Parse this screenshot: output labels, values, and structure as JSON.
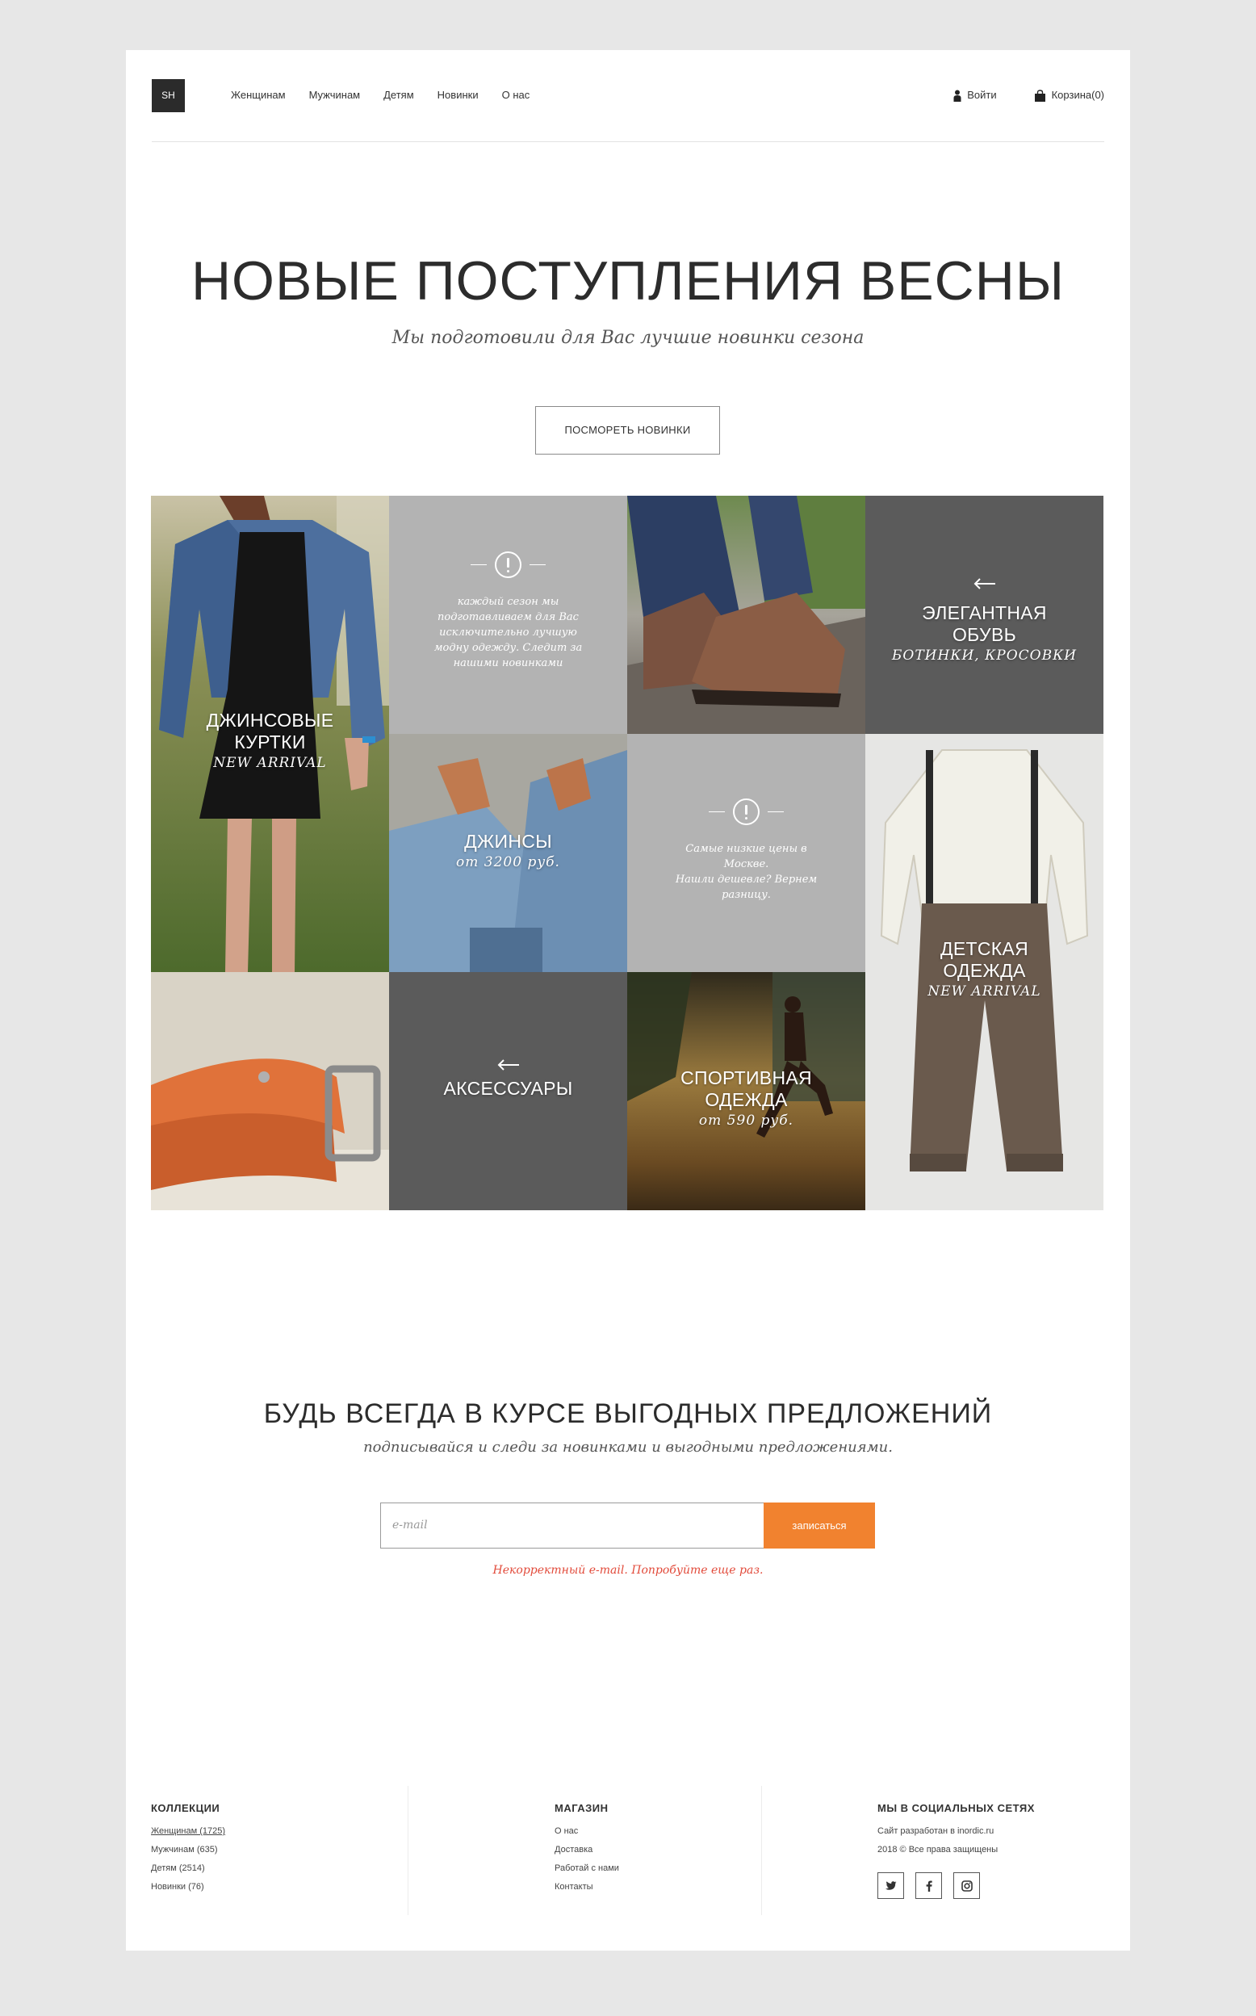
{
  "header": {
    "logo": "SH",
    "nav": [
      "Женщинам",
      "Мужчинам",
      "Детям",
      "Новинки",
      "О нас"
    ],
    "login": "Войти",
    "cart": "Корзина(0)"
  },
  "hero": {
    "title": "НОВЫЕ ПОСТУПЛЕНИЯ ВЕСНЫ",
    "subtitle": "Мы подготовили для Вас лучшие новинки сезона",
    "button": "ПОСМОРЕТЬ НОВИНКИ"
  },
  "tiles": {
    "jackets": {
      "title_1": "ДЖИНСОВЫЕ",
      "title_2": "КУРТКИ",
      "caption": "NEW ARRIVAL"
    },
    "info1": {
      "text_1": "каждый сезон мы",
      "text_2": "подготавливаем для Вас",
      "text_3": "исключительно лучшую",
      "text_4": "модну одежду. Следит за",
      "text_5": "нашими новинками"
    },
    "shoes": {
      "title_1": "ЭЛЕГАНТНАЯ",
      "title_2": "ОБУВЬ",
      "caption": "БОТИНКИ, КРОСОВКИ"
    },
    "jeans": {
      "title": "ДЖИНСЫ",
      "caption": "от 3200 руб."
    },
    "info2": {
      "text_1": "Самые низкие цены в",
      "text_2": "Москве.",
      "text_3": "Нашли дешевле? Вернем",
      "text_4": "разницу."
    },
    "kids": {
      "title_1": "ДЕТСКАЯ",
      "title_2": "ОДЕЖДА",
      "caption": "NEW ARRIVAL"
    },
    "accessories": {
      "title": "АКСЕССУАРЫ"
    },
    "sport": {
      "title_1": "СПОРТИВНАЯ",
      "title_2": "ОДЕЖДА",
      "caption": "от 590 руб."
    }
  },
  "subscribe": {
    "title": "БУДЬ ВСЕГДА В КУРСЕ ВЫГОДНЫХ ПРЕДЛОЖЕНИЙ",
    "text": "подписывайся и следи за новинками и выгодными предложениями.",
    "placeholder": "e-mail",
    "button": "записаться",
    "error": "Некорректный e-mail. Попробуйте еще раз."
  },
  "footer": {
    "collections": {
      "title": "КОЛЛЕКЦИИ",
      "links": [
        "Женщинам (1725)",
        "Мужчинам (635)",
        "Детям (2514)",
        "Новинки (76)"
      ]
    },
    "shop": {
      "title": "МАГАЗИН",
      "links": [
        "О нас",
        "Доставка",
        "Работай с нами",
        "Контакты"
      ]
    },
    "social": {
      "title": "МЫ В СОЦИАЛЬНЫХ СЕТЯХ",
      "line_1": "Сайт разработан в inordic.ru",
      "line_2": "2018 © Все права защищены"
    }
  },
  "colors": {
    "accent": "#f1822f",
    "error": "#e24b3b",
    "tile_light": "#b3b3b3",
    "tile_dark": "#5b5b5b"
  }
}
